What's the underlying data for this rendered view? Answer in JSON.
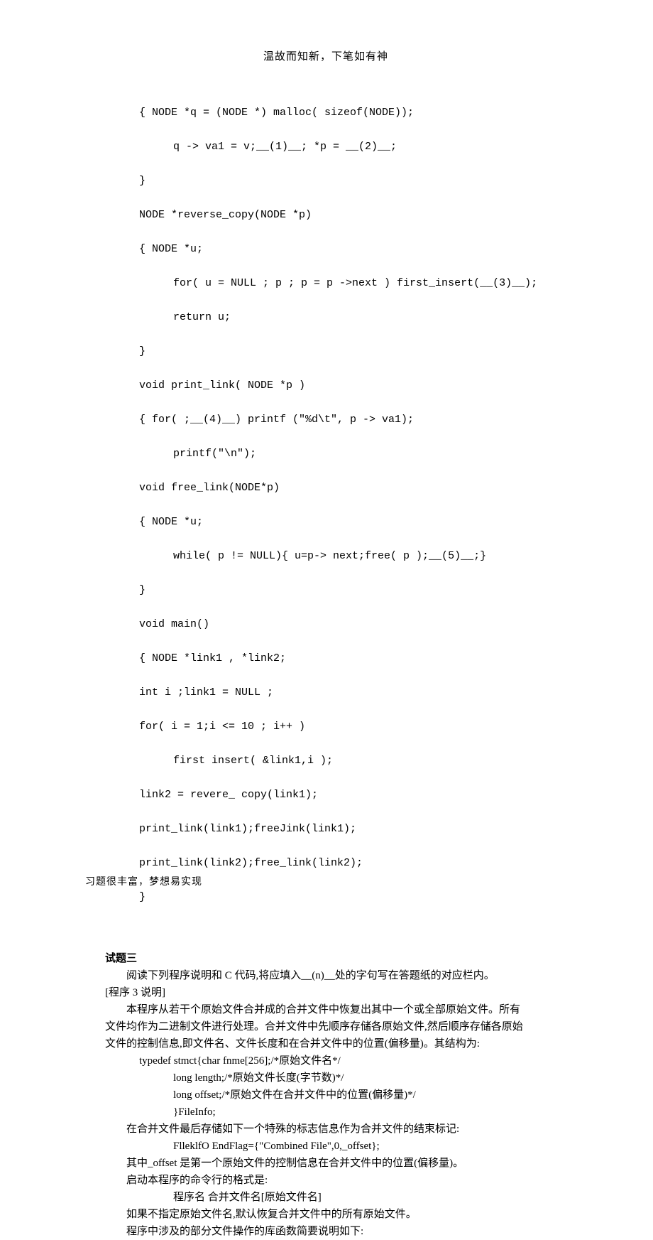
{
  "header": "温故而知新，下笔如有神",
  "footer": "习题很丰富，梦想易实现",
  "code1": {
    "l1": "{ NODE *q = (NODE *) malloc( sizeof(NODE));",
    "l2": "q -> va1 = v;__(1)__; *p = __(2)__;",
    "l3": "}",
    "l4": "NODE *reverse_copy(NODE *p)",
    "l5": "{ NODE *u;",
    "l6": "for( u = NULL ; p ; p = p ->next ) first_insert(__(3)__);",
    "l7": "return u;",
    "l8": "}",
    "l9": "void print_link( NODE *p )",
    "l10": "{ for( ;__(4)__) printf (\"%d\\t\", p -> va1);",
    "l11": "printf(\"\\n\");",
    "l12": "void free_link(NODE*p)",
    "l13": "{ NODE *u;",
    "l14": "while( p != NULL){ u=p-> next;free( p );__(5)__;}",
    "l15": "}",
    "l16": "void main()",
    "l17": "{ NODE *link1 , *link2;",
    "l18": "int i ;link1 = NULL ;",
    "l19": "for( i = 1;i <= 10 ; i++ )",
    "l20": "first insert( &link1,i );",
    "l21": "link2 = revere_ copy(link1);",
    "l22": "print_link(link1);freeJink(link1);",
    "l23": "print_link(link2);free_link(link2);",
    "l24": "}"
  },
  "section3": {
    "title": "试题三",
    "p1": "阅读下列程序说明和 C 代码,将应填入__(n)__处的字句写在答题纸的对应栏内。",
    "p2": "[程序 3 说明]",
    "p3": "本程序从若干个原始文件合并成的合并文件中恢复出其中一个或全部原始文件。所有",
    "p4": "文件均作为二进制文件进行处理。合并文件中先顺序存储各原始文件,然后顺序存储各原始",
    "p5": "文件的控制信息,即文件名、文件长度和在合并文件中的位置(偏移量)。其结构为:",
    "c1": "typedef stmct{char fnme[256];/*原始文件名*/",
    "c2": "long length;/*原始文件长度(字节数)*/",
    "c3": "long offset;/*原始文件在合并文件中的位置(偏移量)*/",
    "c4": "}FileInfo;",
    "p6": "在合并文件最后存储如下一个特殊的标志信息作为合并文件的结束标记:",
    "c5": "FlleklfO EndFlag={\"Combined File\",0,_offset};",
    "p7": "其中_offset 是第一个原始文件的控制信息在合并文件中的位置(偏移量)。",
    "p8": "启动本程序的命令行的格式是:",
    "c6": "程序名      合并文件名[原始文件名]",
    "p9": "如果不指定原始文件名,默认恢复合并文件中的所有原始文件。",
    "p10": "程序中涉及的部分文件操作的库函数简要说明如下:"
  }
}
